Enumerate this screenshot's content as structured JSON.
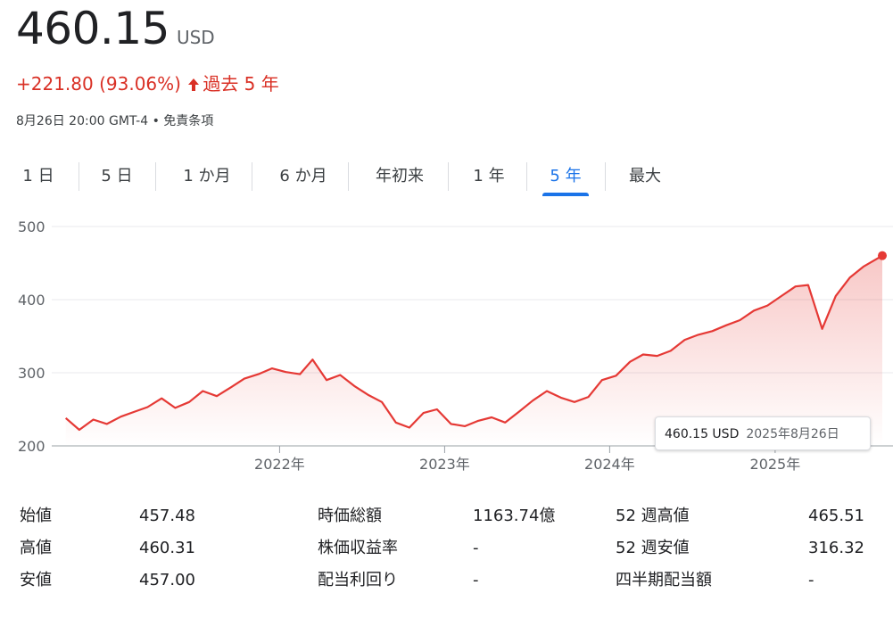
{
  "quote": {
    "price": "460.15",
    "currency": "USD",
    "change": "+221.80 (93.06%)",
    "period": "過去 5 年",
    "timestamp": "8月26日 20:00 GMT-4",
    "separator": "•",
    "disclaimer": "免責条項"
  },
  "colors": {
    "negative_accent": "#d93025",
    "line": "#e53935",
    "active_tab": "#1a73e8"
  },
  "tabs": [
    {
      "label": "1 日",
      "active": false
    },
    {
      "label": "5 日",
      "active": false
    },
    {
      "label": "1 か月",
      "active": false
    },
    {
      "label": "6 か月",
      "active": false
    },
    {
      "label": "年初来",
      "active": false
    },
    {
      "label": "1 年",
      "active": false
    },
    {
      "label": "5 年",
      "active": true
    },
    {
      "label": "最大",
      "active": false
    }
  ],
  "tooltip": {
    "value": "460.15 USD",
    "date": "2025年8月26日"
  },
  "chart_data": {
    "type": "line",
    "title": "",
    "xlabel": "",
    "ylabel": "",
    "ylim": [
      200,
      500
    ],
    "y_ticks": [
      "500",
      "400",
      "300",
      "200"
    ],
    "x_ticks": [
      "2022年",
      "2023年",
      "2024年",
      "2025年"
    ],
    "grid": true,
    "x_start": "2020-08",
    "x_end": "2025-08-26",
    "series": [
      {
        "name": "",
        "points": [
          [
            "2020-09",
            238
          ],
          [
            "2020-10",
            222
          ],
          [
            "2020-11",
            236
          ],
          [
            "2020-12",
            230
          ],
          [
            "2021-01",
            240
          ],
          [
            "2021-02",
            247
          ],
          [
            "2021-03",
            253
          ],
          [
            "2021-04",
            265
          ],
          [
            "2021-05",
            252
          ],
          [
            "2021-06",
            260
          ],
          [
            "2021-07",
            275
          ],
          [
            "2021-08",
            268
          ],
          [
            "2021-09",
            280
          ],
          [
            "2021-10",
            292
          ],
          [
            "2021-11",
            298
          ],
          [
            "2021-12",
            306
          ],
          [
            "2022-01",
            301
          ],
          [
            "2022-02",
            298
          ],
          [
            "2022-03",
            318
          ],
          [
            "2022-04",
            290
          ],
          [
            "2022-05",
            297
          ],
          [
            "2022-06",
            282
          ],
          [
            "2022-07",
            270
          ],
          [
            "2022-08",
            260
          ],
          [
            "2022-09",
            232
          ],
          [
            "2022-10",
            225
          ],
          [
            "2022-11",
            245
          ],
          [
            "2022-12",
            250
          ],
          [
            "2023-01",
            230
          ],
          [
            "2023-02",
            227
          ],
          [
            "2023-03",
            234
          ],
          [
            "2023-04",
            239
          ],
          [
            "2023-05",
            232
          ],
          [
            "2023-06",
            247
          ],
          [
            "2023-07",
            262
          ],
          [
            "2023-08",
            275
          ],
          [
            "2023-09",
            266
          ],
          [
            "2023-10",
            260
          ],
          [
            "2023-11",
            267
          ],
          [
            "2023-12",
            290
          ],
          [
            "2024-01",
            296
          ],
          [
            "2024-02",
            315
          ],
          [
            "2024-03",
            325
          ],
          [
            "2024-04",
            323
          ],
          [
            "2024-05",
            330
          ],
          [
            "2024-06",
            345
          ],
          [
            "2024-07",
            352
          ],
          [
            "2024-08",
            357
          ],
          [
            "2024-09",
            365
          ],
          [
            "2024-10",
            372
          ],
          [
            "2024-11",
            385
          ],
          [
            "2024-12",
            392
          ],
          [
            "2025-01",
            405
          ],
          [
            "2025-02",
            418
          ],
          [
            "2025-03",
            420
          ],
          [
            "2025-04",
            360
          ],
          [
            "2025-05",
            405
          ],
          [
            "2025-06",
            430
          ],
          [
            "2025-07",
            445
          ],
          [
            "2025-08-26",
            460.15
          ]
        ]
      }
    ]
  },
  "stats": {
    "col1": [
      {
        "label": "始値",
        "value": "457.48"
      },
      {
        "label": "高値",
        "value": "460.31"
      },
      {
        "label": "安値",
        "value": "457.00"
      }
    ],
    "col2": [
      {
        "label": "時価総額",
        "value": "1163.74億"
      },
      {
        "label": "株価収益率",
        "value": "-"
      },
      {
        "label": "配当利回り",
        "value": "-"
      }
    ],
    "col3": [
      {
        "label": "52 週高値",
        "value": "465.51"
      },
      {
        "label": "52 週安値",
        "value": "316.32"
      },
      {
        "label": "四半期配当額",
        "value": "-"
      }
    ]
  }
}
